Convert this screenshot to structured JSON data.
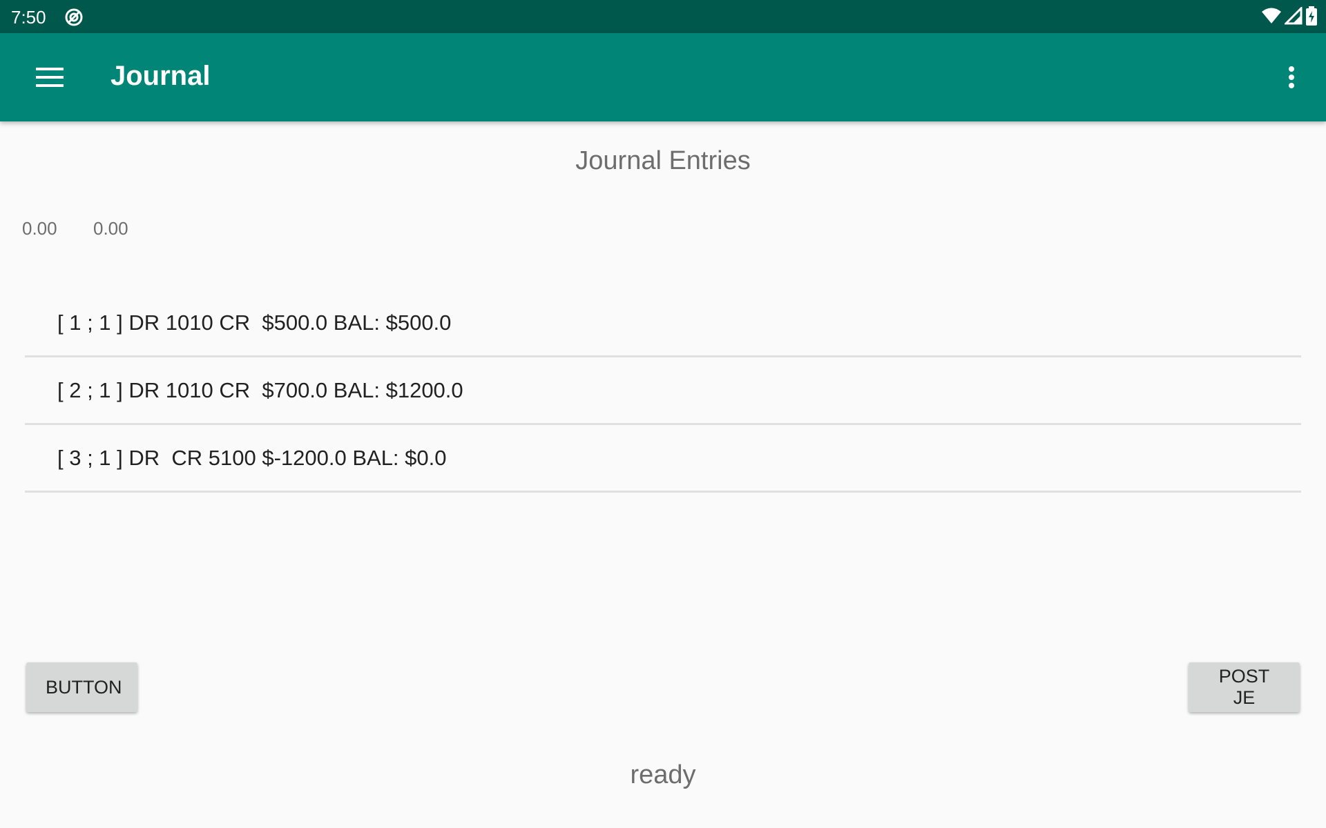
{
  "status_bar": {
    "time": "7:50",
    "icons": [
      "sync-icon",
      "wifi-icon",
      "signal-icon",
      "battery-charging-icon"
    ]
  },
  "app_bar": {
    "title": "Journal",
    "menu_icon": "hamburger-menu-icon",
    "overflow_icon": "more-vert-icon",
    "color": "#008577",
    "status_color": "#00574b"
  },
  "main": {
    "section_title": "Journal Entries",
    "totals": {
      "debit": "0.00",
      "credit": "0.00"
    },
    "entries": [
      "[ 1 ; 1 ] DR 1010 CR  $500.0 BAL: $500.0",
      "[ 2 ; 1 ] DR 1010 CR  $700.0 BAL: $1200.0",
      "[ 3 ; 1 ] DR  CR 5100 $-1200.0 BAL: $0.0"
    ],
    "buttons": {
      "left_label": "BUTTON",
      "right_label": "POST JE"
    },
    "status": "ready"
  }
}
